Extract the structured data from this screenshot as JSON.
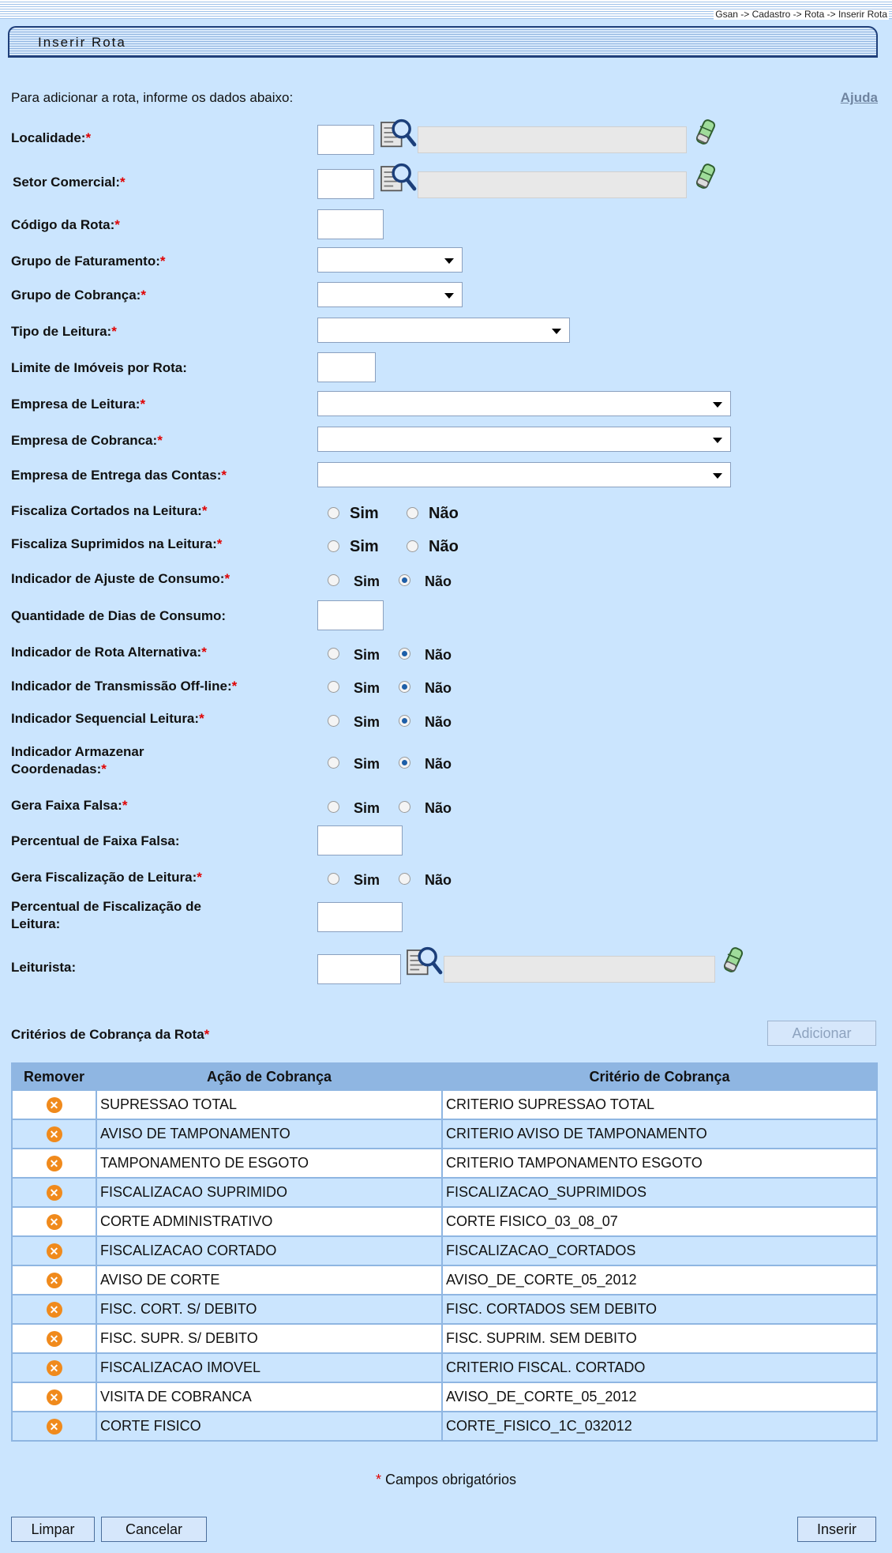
{
  "breadcrumb": "Gsan -> Cadastro -> Rota -> Inserir Rota",
  "page_title": "Inserir Rota",
  "intro": "Para adicionar a rota, informe os dados abaixo:",
  "help_link": "Ajuda",
  "required_mark": "*",
  "radio_yes": "Sim",
  "radio_no": "Não",
  "fields": {
    "localidade": "Localidade:",
    "setor": "Setor Comercial:",
    "codigo_rota": "Código da Rota:",
    "grupo_fat": "Grupo de Faturamento:",
    "grupo_cob": "Grupo de Cobrança:",
    "tipo_leitura": "Tipo de Leitura:",
    "limite_imoveis": "Limite de Imóveis por Rota:",
    "empresa_leitura": "Empresa de Leitura:",
    "empresa_cobranca": "Empresa de Cobranca:",
    "empresa_entrega": "Empresa de Entrega das Contas:",
    "fisc_cortados": "Fiscaliza Cortados na Leitura:",
    "fisc_suprimidos": "Fiscaliza Suprimidos na Leitura:",
    "ind_ajuste": "Indicador de Ajuste de Consumo:",
    "qtd_dias": "Quantidade de Dias de Consumo:",
    "ind_rota_alt": "Indicador de Rota Alternativa:",
    "ind_offline": "Indicador de Transmissão Off-line:",
    "ind_sequencial": "Indicador Sequencial Leitura:",
    "ind_armazenar_1": "Indicador Armazenar",
    "ind_armazenar_2": "Coordenadas:",
    "gera_faixa": "Gera Faixa Falsa:",
    "perc_faixa": "Percentual de Faixa Falsa:",
    "gera_fisc": "Gera Fiscalização de Leitura:",
    "perc_fisc_1": "Percentual de Fiscalização de",
    "perc_fisc_2": "Leitura:",
    "leiturista": "Leiturista:"
  },
  "criteria": {
    "title": "Critérios de Cobrança da Rota",
    "add_button": "Adicionar",
    "headers": [
      "Remover",
      "Ação de Cobrança",
      "Critério de Cobrança"
    ],
    "rows": [
      [
        "SUPRESSAO TOTAL",
        "CRITERIO SUPRESSAO TOTAL"
      ],
      [
        "AVISO DE TAMPONAMENTO",
        "CRITERIO AVISO DE TAMPONAMENTO"
      ],
      [
        "TAMPONAMENTO DE ESGOTO",
        "CRITERIO TAMPONAMENTO ESGOTO"
      ],
      [
        "FISCALIZACAO SUPRIMIDO",
        "FISCALIZACAO_SUPRIMIDOS"
      ],
      [
        "CORTE ADMINISTRATIVO",
        "CORTE FISICO_03_08_07"
      ],
      [
        "FISCALIZACAO CORTADO",
        "FISCALIZACAO_CORTADOS"
      ],
      [
        "AVISO DE CORTE",
        "AVISO_DE_CORTE_05_2012"
      ],
      [
        "FISC. CORT. S/ DEBITO",
        "FISC. CORTADOS SEM DEBITO"
      ],
      [
        "FISC. SUPR. S/ DEBITO",
        "FISC. SUPRIM. SEM DEBITO"
      ],
      [
        "FISCALIZACAO IMOVEL",
        "CRITERIO FISCAL. CORTADO"
      ],
      [
        "VISITA DE COBRANCA",
        "AVISO_DE_CORTE_05_2012"
      ],
      [
        "CORTE FISICO",
        "CORTE_FISICO_1C_032012"
      ]
    ]
  },
  "footer_note": "Campos obrigatórios",
  "buttons": {
    "limpar": "Limpar",
    "cancelar": "Cancelar",
    "inserir": "Inserir"
  },
  "icons": {
    "search": "magnifier-search-icon",
    "clear": "eraser-icon",
    "remove": "remove-x-icon"
  },
  "colors": {
    "background": "#cbe5fe",
    "required": "#e00000",
    "title_border": "#1f3f7a",
    "remove_icon": "#f08a1c"
  }
}
